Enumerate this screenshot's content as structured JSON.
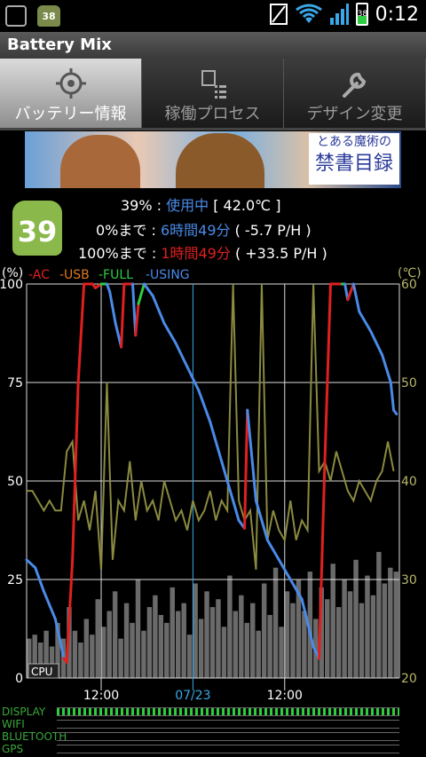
{
  "status_bar": {
    "time": "0:12",
    "battery_level": "38",
    "notification_badge": "38"
  },
  "app_title": "Battery Mix",
  "tabs": [
    {
      "label": "バッテリー情報",
      "icon": "target-icon",
      "active": true
    },
    {
      "label": "稼働プロセス",
      "icon": "process-list-icon",
      "active": false
    },
    {
      "label": "デザイン変更",
      "icon": "wrench-icon",
      "active": false
    }
  ],
  "banner": {
    "logo_line1": "とある魔術の",
    "logo_line2": "禁書目録"
  },
  "battery": {
    "level_badge": "39",
    "line1_prefix": "39% : ",
    "line1_status": "使用中",
    "line1_temp": " [ 42.0℃ ]",
    "line2_prefix": "0%まで : ",
    "line2_time": "6時間49分",
    "line2_rate": " ( -5.7 P/H )",
    "line3_prefix": "100%まで : ",
    "line3_time": "1時間49分",
    "line3_rate": " ( +33.5 P/H )"
  },
  "colors": {
    "ac": "#e02020",
    "usb": "#e07a20",
    "full": "#2ecc40",
    "using": "#4a8ae8",
    "temp": "#8a8a40",
    "cpu": "#6a6a6a",
    "grid": "#ffffff"
  },
  "chart_data": {
    "type": "line",
    "left_axis_unit": "(%)",
    "right_axis_unit": "(℃)",
    "left_ticks": [
      "100",
      "75",
      "50",
      "25",
      "0"
    ],
    "right_ticks": [
      "60",
      "50",
      "40",
      "30",
      "20"
    ],
    "x_ticks": [
      "12:00",
      "07/23",
      "12:00"
    ],
    "cpu_label": "CPU",
    "legend": [
      {
        "name": "AC",
        "color": "#e02020"
      },
      {
        "name": "USB",
        "color": "#e07a20"
      },
      {
        "name": "FULL",
        "color": "#2ecc40"
      },
      {
        "name": "USING",
        "color": "#4a8ae8"
      }
    ],
    "ylim": [
      0,
      100
    ],
    "temp_ylim": [
      20,
      60
    ],
    "battery_series": [
      {
        "t": 0,
        "v": 30,
        "mode": "using"
      },
      {
        "t": 1.5,
        "v": 28,
        "mode": "using"
      },
      {
        "t": 3,
        "v": 22,
        "mode": "using"
      },
      {
        "t": 5,
        "v": 15,
        "mode": "using"
      },
      {
        "t": 6.5,
        "v": 5,
        "mode": "using"
      },
      {
        "t": 7,
        "v": 4,
        "mode": "ac"
      },
      {
        "t": 8,
        "v": 30,
        "mode": "ac"
      },
      {
        "t": 9,
        "v": 75,
        "mode": "ac"
      },
      {
        "t": 10,
        "v": 100,
        "mode": "ac"
      },
      {
        "t": 11.5,
        "v": 100,
        "mode": "ac"
      },
      {
        "t": 12,
        "v": 99,
        "mode": "ac"
      },
      {
        "t": 13,
        "v": 100,
        "mode": "ac"
      },
      {
        "t": 14,
        "v": 100,
        "mode": "full"
      },
      {
        "t": 14.5,
        "v": 98,
        "mode": "using"
      },
      {
        "t": 15.5,
        "v": 90,
        "mode": "using"
      },
      {
        "t": 16.5,
        "v": 84,
        "mode": "using"
      },
      {
        "t": 17,
        "v": 100,
        "mode": "ac"
      },
      {
        "t": 18.5,
        "v": 100,
        "mode": "ac"
      },
      {
        "t": 19,
        "v": 87,
        "mode": "using"
      },
      {
        "t": 19.5,
        "v": 95,
        "mode": "ac"
      },
      {
        "t": 20.5,
        "v": 100,
        "mode": "full"
      },
      {
        "t": 22,
        "v": 97,
        "mode": "using"
      },
      {
        "t": 24,
        "v": 90,
        "mode": "using"
      },
      {
        "t": 26,
        "v": 85,
        "mode": "using"
      },
      {
        "t": 28,
        "v": 79,
        "mode": "using"
      },
      {
        "t": 30,
        "v": 73,
        "mode": "using"
      },
      {
        "t": 32,
        "v": 65,
        "mode": "using"
      },
      {
        "t": 34,
        "v": 55,
        "mode": "using"
      },
      {
        "t": 36,
        "v": 45,
        "mode": "using"
      },
      {
        "t": 37,
        "v": 40,
        "mode": "using"
      },
      {
        "t": 38,
        "v": 38,
        "mode": "using"
      },
      {
        "t": 38.5,
        "v": 68,
        "mode": "ac"
      },
      {
        "t": 40,
        "v": 45,
        "mode": "using"
      },
      {
        "t": 42,
        "v": 35,
        "mode": "using"
      },
      {
        "t": 44,
        "v": 30,
        "mode": "using"
      },
      {
        "t": 46,
        "v": 25,
        "mode": "using"
      },
      {
        "t": 48,
        "v": 20,
        "mode": "using"
      },
      {
        "t": 50,
        "v": 8,
        "mode": "using"
      },
      {
        "t": 51,
        "v": 5,
        "mode": "using"
      },
      {
        "t": 52,
        "v": 55,
        "mode": "ac"
      },
      {
        "t": 53,
        "v": 100,
        "mode": "ac"
      },
      {
        "t": 55,
        "v": 100,
        "mode": "ac"
      },
      {
        "t": 55.5,
        "v": 100,
        "mode": "full"
      },
      {
        "t": 56,
        "v": 96,
        "mode": "using"
      },
      {
        "t": 57,
        "v": 100,
        "mode": "ac"
      },
      {
        "t": 58,
        "v": 93,
        "mode": "using"
      },
      {
        "t": 60,
        "v": 88,
        "mode": "using"
      },
      {
        "t": 62,
        "v": 82,
        "mode": "using"
      },
      {
        "t": 63.5,
        "v": 75,
        "mode": "using"
      },
      {
        "t": 64,
        "v": 68,
        "mode": "using"
      },
      {
        "t": 64.5,
        "v": 67,
        "mode": "using"
      }
    ],
    "temperature_series": [
      [
        0,
        39
      ],
      [
        1,
        39
      ],
      [
        2,
        38
      ],
      [
        3,
        37
      ],
      [
        4,
        38
      ],
      [
        5,
        37
      ],
      [
        6,
        37
      ],
      [
        7,
        43
      ],
      [
        8,
        44
      ],
      [
        9,
        36
      ],
      [
        10,
        38
      ],
      [
        11,
        35
      ],
      [
        12,
        39
      ],
      [
        13,
        31
      ],
      [
        14,
        50
      ],
      [
        15,
        32
      ],
      [
        16,
        38
      ],
      [
        17,
        37
      ],
      [
        18,
        42
      ],
      [
        19,
        36
      ],
      [
        20,
        40
      ],
      [
        21,
        37
      ],
      [
        22,
        38
      ],
      [
        23,
        36
      ],
      [
        24,
        40
      ],
      [
        25,
        38
      ],
      [
        26,
        36
      ],
      [
        27,
        37
      ],
      [
        28,
        35
      ],
      [
        29,
        38
      ],
      [
        30,
        36
      ],
      [
        31,
        37
      ],
      [
        32,
        39
      ],
      [
        33,
        36
      ],
      [
        34,
        38
      ],
      [
        35,
        37
      ],
      [
        36,
        60
      ],
      [
        37,
        38
      ],
      [
        38,
        36
      ],
      [
        39,
        37
      ],
      [
        40,
        31
      ],
      [
        41,
        60
      ],
      [
        42,
        34
      ],
      [
        43,
        37
      ],
      [
        44,
        35
      ],
      [
        45,
        34
      ],
      [
        46,
        38
      ],
      [
        47,
        34
      ],
      [
        48,
        36
      ],
      [
        49,
        35
      ],
      [
        50,
        60
      ],
      [
        51,
        41
      ],
      [
        52,
        42
      ],
      [
        53,
        40
      ],
      [
        54,
        43
      ],
      [
        55,
        41
      ],
      [
        56,
        39
      ],
      [
        57,
        38
      ],
      [
        58,
        40
      ],
      [
        59,
        39
      ],
      [
        60,
        38
      ],
      [
        61,
        40
      ],
      [
        62,
        41
      ],
      [
        63,
        44
      ],
      [
        64,
        41
      ]
    ],
    "cpu_series": [
      10,
      11,
      9,
      12,
      8,
      14,
      10,
      18,
      12,
      9,
      15,
      11,
      20,
      13,
      17,
      22,
      10,
      19,
      14,
      25,
      12,
      18,
      21,
      16,
      14,
      23,
      17,
      19,
      11,
      24,
      15,
      22,
      18,
      20,
      13,
      26,
      17,
      21,
      14,
      19,
      12,
      24,
      16,
      28,
      13,
      22,
      19,
      25,
      17,
      27,
      15,
      23,
      20,
      29,
      18,
      25,
      22,
      30,
      19,
      26,
      21,
      32,
      24,
      28,
      27
    ]
  },
  "bottom_rows": [
    "DISPLAY",
    "WIFI",
    "BLUETOOTH",
    "GPS"
  ]
}
